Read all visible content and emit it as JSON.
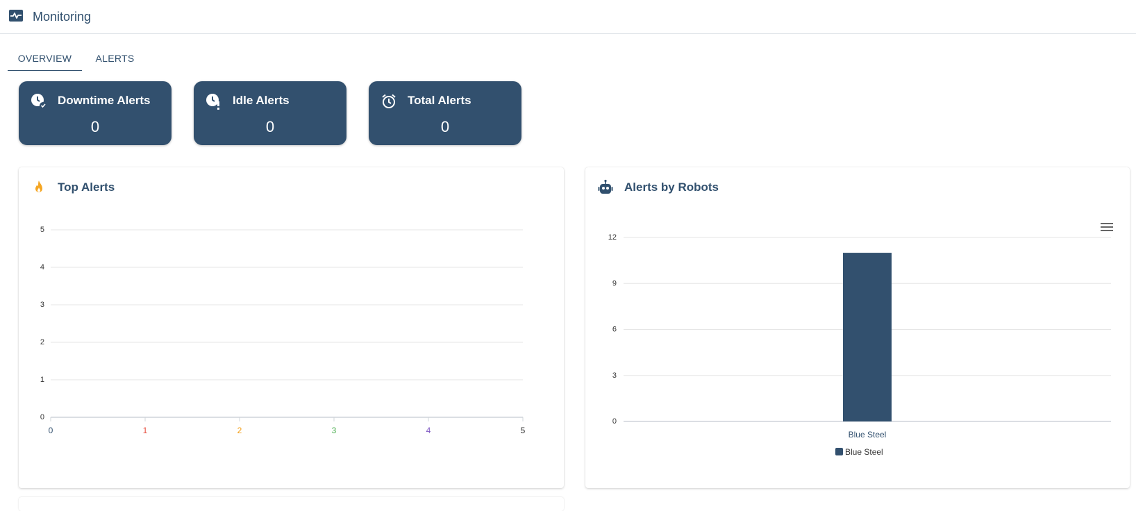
{
  "header": {
    "title": "Monitoring",
    "icon": "pulse-monitor-icon"
  },
  "tabs": [
    {
      "label": "OVERVIEW",
      "active": true
    },
    {
      "label": "ALERTS",
      "active": false
    }
  ],
  "stats": [
    {
      "title": "Downtime Alerts",
      "value": "0",
      "icon": "clock-check-icon"
    },
    {
      "title": "Idle Alerts",
      "value": "0",
      "icon": "clock-alert-icon"
    },
    {
      "title": "Total Alerts",
      "value": "0",
      "icon": "alarm-clock-icon"
    }
  ],
  "colors": {
    "primary": "#32506e",
    "fire": "#f5a623",
    "tick_1": "#e74c3c",
    "tick_2": "#f39c12",
    "tick_3": "#4caf50",
    "tick_4": "#7e57c2",
    "tick_5": "#333333"
  },
  "top_alerts": {
    "title": "Top Alerts",
    "icon": "fire-icon"
  },
  "alerts_by_robots": {
    "title": "Alerts by Robots",
    "icon": "robot-icon",
    "menu_icon": "hamburger-menu-icon"
  },
  "chart_data": [
    {
      "type": "bar",
      "title": "Top Alerts",
      "x_ticks": [
        "0",
        "1",
        "2",
        "3",
        "4",
        "5"
      ],
      "y_ticks": [
        "0",
        "1",
        "2",
        "3",
        "4",
        "5"
      ],
      "xlim": [
        0,
        5
      ],
      "ylim": [
        0,
        5
      ],
      "series": [],
      "grid": true
    },
    {
      "type": "bar",
      "title": "Alerts by Robots",
      "categories": [
        "Blue Steel"
      ],
      "series": [
        {
          "name": "Blue Steel",
          "values": [
            11
          ],
          "color": "#32506e"
        }
      ],
      "y_ticks": [
        "0",
        "3",
        "6",
        "9",
        "12"
      ],
      "ylim": [
        0,
        12
      ],
      "legend": "bottom",
      "grid": true
    }
  ]
}
